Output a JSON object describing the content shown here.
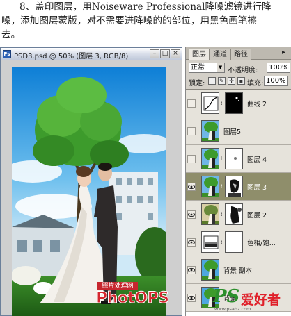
{
  "instruction": {
    "line1": "8、盖印图层，用Noiseware Professional降噪滤镜进行降",
    "line2": "噪，添加图层蒙版，对不需要进降噪的的部位，用黑色画笔擦",
    "line3": "去。"
  },
  "document": {
    "title": "PSD3.psd @ 50% (图层 3, RGB/8)",
    "buttons": [
      "minimize",
      "maximize",
      "close"
    ],
    "watermark_small": "照片处理网",
    "watermark": "PhotOPS"
  },
  "layers_panel": {
    "tabs": [
      {
        "label": "图层",
        "active": true
      },
      {
        "label": "通道",
        "active": false
      },
      {
        "label": "路径",
        "active": false
      }
    ],
    "blend_mode": "正常",
    "opacity_label": "不透明度:",
    "opacity_value": "100%",
    "lock_label": "锁定:",
    "fill_label": "填充:",
    "fill_value": "100%",
    "layers": [
      {
        "name": "曲线 2",
        "visible": false,
        "selected": false,
        "has_mask": true,
        "thumb": "curves",
        "mask": "black-dots"
      },
      {
        "name": "图层5",
        "visible": false,
        "selected": false,
        "has_mask": false,
        "thumb": "photo"
      },
      {
        "name": "图层 4",
        "visible": false,
        "selected": false,
        "has_mask": true,
        "thumb": "photo",
        "mask": "light"
      },
      {
        "name": "图层 3",
        "visible": true,
        "selected": true,
        "has_mask": true,
        "thumb": "photo",
        "mask": "dark"
      },
      {
        "name": "图层 2",
        "visible": true,
        "selected": false,
        "has_mask": true,
        "thumb": "photo-warm",
        "mask": "dark"
      },
      {
        "name": "色相/饱...",
        "visible": true,
        "selected": false,
        "has_mask": true,
        "thumb": "adjust",
        "mask": "white"
      },
      {
        "name": "背景 副本",
        "visible": true,
        "selected": false,
        "has_mask": false,
        "thumb": "photo"
      },
      {
        "name": "背景",
        "visible": true,
        "selected": false,
        "has_mask": false,
        "thumb": "photo"
      }
    ]
  },
  "site_watermark": {
    "logo": "PS",
    "text": "爱好者",
    "url": "www.psahz.com"
  },
  "colors": {
    "selected_layer": "#8f8e6b",
    "panel_bg": "#d4d0c8",
    "watermark_red": "#e0202a",
    "watermark_green": "#2c8f2c"
  }
}
